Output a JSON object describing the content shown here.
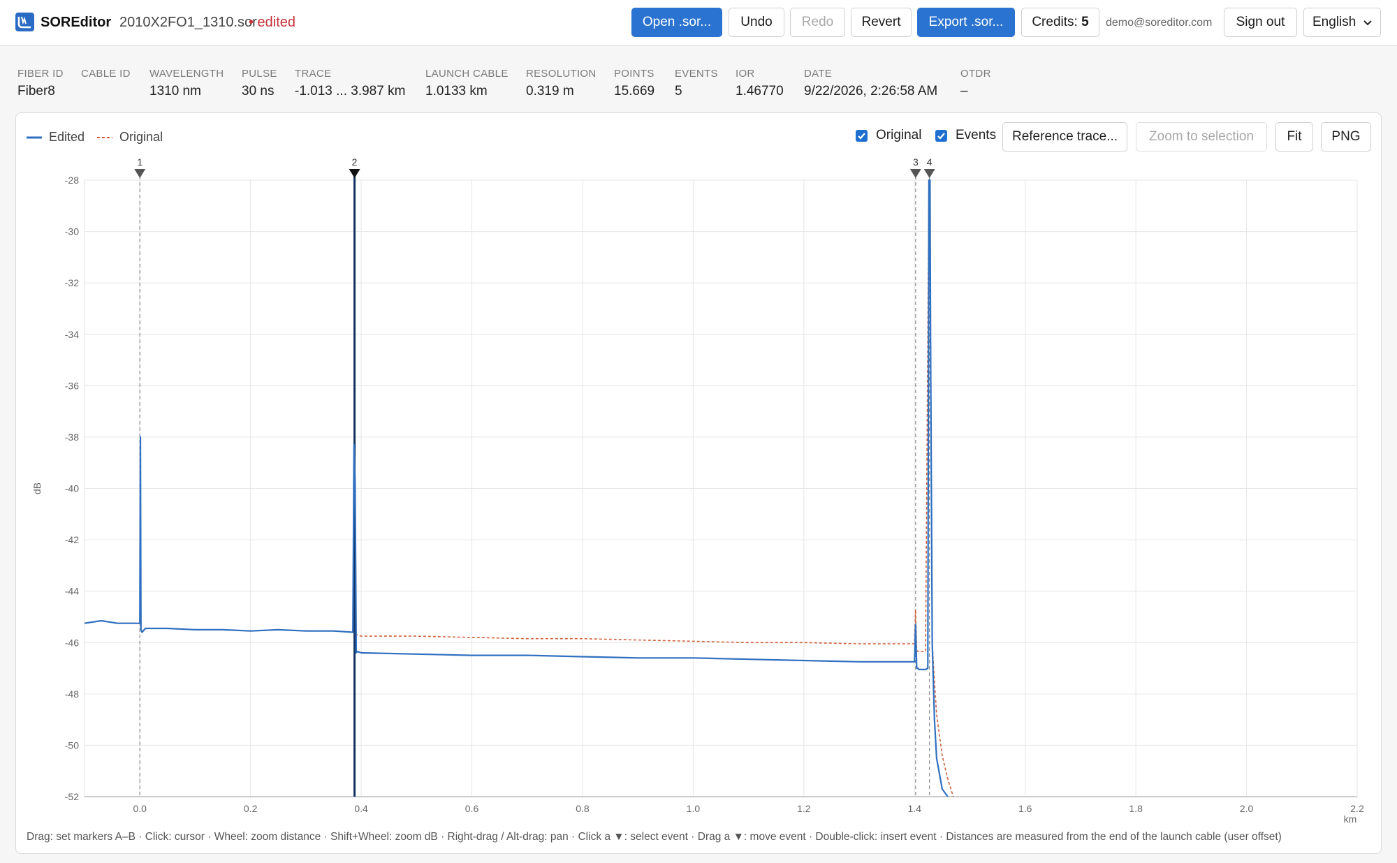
{
  "app": {
    "name": "SOREditor",
    "file_name": "2010X2FO1_1310.sor",
    "edited_label": "• edited"
  },
  "toolbar": {
    "open_label": "Open .sor...",
    "undo_label": "Undo",
    "redo_label": "Redo",
    "revert_label": "Revert",
    "export_label": "Export .sor...",
    "credits_label": "Credits:",
    "credits_value": "5",
    "account_email": "demo@soreditor.com",
    "signout_label": "Sign out",
    "language": "English"
  },
  "info": [
    {
      "label": "FIBER ID",
      "value": "Fiber8"
    },
    {
      "label": "CABLE ID",
      "value": ""
    },
    {
      "label": "WAVELENGTH",
      "value": "1310 nm"
    },
    {
      "label": "PULSE",
      "value": "30 ns"
    },
    {
      "label": "TRACE",
      "value": "-1.013 ... 3.987 km"
    },
    {
      "label": "LAUNCH CABLE",
      "value": "1.0133 km"
    },
    {
      "label": "RESOLUTION",
      "value": "0.319 m"
    },
    {
      "label": "POINTS",
      "value": "15.669"
    },
    {
      "label": "EVENTS",
      "value": "5"
    },
    {
      "label": "IOR",
      "value": "1.46770"
    },
    {
      "label": "DATE",
      "value": "9/22/2026, 2:26:58 AM"
    },
    {
      "label": "OTDR",
      "value": "–"
    }
  ],
  "panel": {
    "legend_edited": "Edited",
    "legend_original": "Original",
    "show_original_label": "Original",
    "show_original_checked": true,
    "show_events_label": "Events",
    "show_events_checked": true,
    "reference_label": "Reference trace...",
    "zoom_label": "Zoom to selection",
    "fit_label": "Fit",
    "png_label": "PNG",
    "hint": "Drag: set markers A–B · Click: cursor · Wheel: zoom distance · Shift+Wheel: zoom dB · Right-drag / Alt-drag: pan · Click a ▼: select event · Drag a ▼: move event · Double-click: insert event · Distances are measured from the end of the launch cable (user offset)"
  },
  "colors": {
    "edited": "#2f6fc0",
    "original": "#d2603c",
    "primary_button": "#2a73d0",
    "edited_flag": "#c8323a"
  },
  "chart_data": {
    "type": "line",
    "xlabel": "km",
    "ylabel": "dB",
    "xlim": [
      -0.1,
      2.2
    ],
    "ylim": [
      -52,
      -28
    ],
    "xticks": [
      "0.0",
      "0.2",
      "0.4",
      "0.6",
      "0.8",
      "1.0",
      "1.2",
      "1.4",
      "1.6",
      "1.8",
      "2.0",
      "2.2"
    ],
    "yticks": [
      "-28",
      "-30",
      "-32",
      "-34",
      "-36",
      "-38",
      "-40",
      "-42",
      "-44",
      "-46",
      "-48",
      "-50",
      "-52"
    ],
    "grid": true,
    "legend": "top-left",
    "events": [
      {
        "label": "1",
        "x": 0.0
      },
      {
        "label": "2",
        "x": 0.388,
        "selected": true
      },
      {
        "label": "3",
        "x": 1.402
      },
      {
        "label": "4",
        "x": 1.427
      }
    ],
    "series": [
      {
        "name": "Edited",
        "x": [
          -0.1,
          -0.07,
          -0.04,
          -0.01,
          0.0,
          0.001,
          0.002,
          0.004,
          0.01,
          0.05,
          0.1,
          0.15,
          0.2,
          0.25,
          0.3,
          0.35,
          0.385,
          0.387,
          0.389,
          0.391,
          0.393,
          0.4,
          0.5,
          0.6,
          0.7,
          0.8,
          0.9,
          1.0,
          1.1,
          1.2,
          1.3,
          1.4,
          1.402,
          1.404,
          1.406,
          1.408,
          1.42,
          1.424,
          1.426,
          1.428,
          1.429,
          1.432,
          1.436,
          1.44,
          1.45,
          1.46
        ],
        "y": [
          -45.25,
          -45.15,
          -45.25,
          -45.25,
          -45.25,
          -38.0,
          -45.5,
          -45.6,
          -45.45,
          -45.45,
          -45.5,
          -45.5,
          -45.55,
          -45.5,
          -45.55,
          -45.55,
          -45.6,
          -38.3,
          -39.8,
          -46.4,
          -46.35,
          -46.4,
          -46.45,
          -46.5,
          -46.5,
          -46.55,
          -46.6,
          -46.6,
          -46.65,
          -46.7,
          -46.75,
          -46.75,
          -45.3,
          -47.0,
          -47.0,
          -47.05,
          -47.05,
          -47.0,
          -28.0,
          -28.0,
          -34.0,
          -46.0,
          -49.0,
          -50.5,
          -51.7,
          -52.0
        ]
      },
      {
        "name": "Original",
        "x": [
          -0.1,
          -0.07,
          -0.04,
          -0.01,
          0.0,
          0.001,
          0.002,
          0.004,
          0.01,
          0.05,
          0.1,
          0.15,
          0.2,
          0.25,
          0.3,
          0.35,
          0.385,
          0.387,
          0.389,
          0.391,
          0.393,
          0.4,
          0.5,
          0.6,
          0.7,
          0.8,
          0.9,
          1.0,
          1.1,
          1.2,
          1.3,
          1.4,
          1.402,
          1.404,
          1.406,
          1.42,
          1.426,
          1.428,
          1.429,
          1.432,
          1.436,
          1.44,
          1.45,
          1.46,
          1.47
        ],
        "y": [
          -45.25,
          -45.15,
          -45.25,
          -45.25,
          -45.25,
          -38.0,
          -45.5,
          -45.6,
          -45.45,
          -45.45,
          -45.5,
          -45.5,
          -45.55,
          -45.5,
          -45.55,
          -45.55,
          -45.6,
          -38.3,
          -39.8,
          -45.7,
          -45.7,
          -45.75,
          -45.75,
          -45.8,
          -45.85,
          -45.85,
          -45.9,
          -45.95,
          -46.0,
          -46.0,
          -46.05,
          -46.05,
          -44.7,
          -46.3,
          -46.35,
          -46.35,
          -28.0,
          -28.0,
          -34.0,
          -46.0,
          -47.5,
          -48.8,
          -50.4,
          -51.3,
          -52.0
        ]
      }
    ]
  }
}
